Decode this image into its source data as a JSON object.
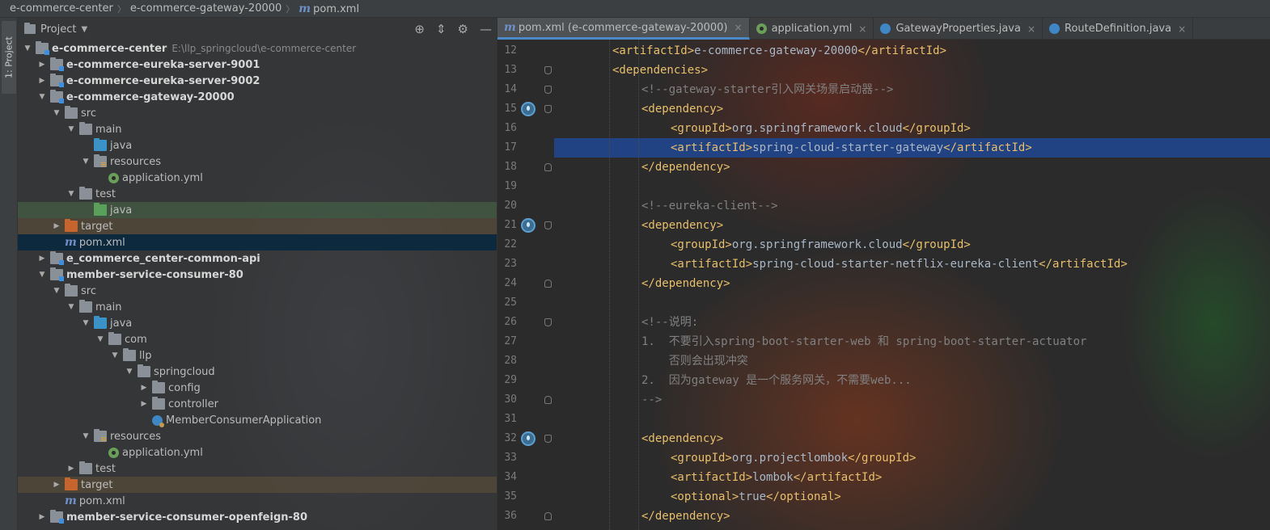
{
  "breadcrumb": {
    "items": [
      "e-commerce-center",
      "e-commerce-gateway-20000",
      "pom.xml"
    ]
  },
  "tool_window": {
    "label": "1: Project"
  },
  "project_panel": {
    "title": "Project",
    "icons": [
      "locate-icon",
      "collapse-icon",
      "gear-icon",
      "minimize-icon"
    ],
    "tree": [
      {
        "label": "e-commerce-center",
        "path": "E:\\llp_springcloud\\e-commerce-center",
        "depth": 0,
        "expanded": true,
        "icon": "module-folder",
        "bold": true
      },
      {
        "label": "e-commerce-eureka-server-9001",
        "depth": 1,
        "expanded": false,
        "icon": "module-folder",
        "bold": true
      },
      {
        "label": "e-commerce-eureka-server-9002",
        "depth": 1,
        "expanded": false,
        "icon": "module-folder",
        "bold": true
      },
      {
        "label": "e-commerce-gateway-20000",
        "depth": 1,
        "expanded": true,
        "icon": "module-folder",
        "bold": true
      },
      {
        "label": "src",
        "depth": 2,
        "expanded": true,
        "icon": "folder"
      },
      {
        "label": "main",
        "depth": 3,
        "expanded": true,
        "icon": "folder"
      },
      {
        "label": "java",
        "depth": 4,
        "icon": "source-folder"
      },
      {
        "label": "resources",
        "depth": 4,
        "expanded": true,
        "icon": "resources-folder"
      },
      {
        "label": "application.yml",
        "depth": 5,
        "icon": "yml-file"
      },
      {
        "label": "test",
        "depth": 3,
        "expanded": true,
        "icon": "folder"
      },
      {
        "label": "java",
        "depth": 4,
        "icon": "test-folder",
        "highlight": "green"
      },
      {
        "label": "target",
        "depth": 2,
        "expanded": false,
        "icon": "excluded-folder",
        "highlight": "orange"
      },
      {
        "label": "pom.xml",
        "depth": 2,
        "icon": "maven-file",
        "highlight": "selected"
      },
      {
        "label": "e_commerce_center-common-api",
        "depth": 1,
        "expanded": false,
        "icon": "module-folder",
        "bold": true
      },
      {
        "label": "member-service-consumer-80",
        "depth": 1,
        "expanded": true,
        "icon": "module-folder",
        "bold": true
      },
      {
        "label": "src",
        "depth": 2,
        "expanded": true,
        "icon": "folder"
      },
      {
        "label": "main",
        "depth": 3,
        "expanded": true,
        "icon": "folder"
      },
      {
        "label": "java",
        "depth": 4,
        "expanded": true,
        "icon": "source-folder"
      },
      {
        "label": "com",
        "depth": 5,
        "expanded": true,
        "icon": "package-folder"
      },
      {
        "label": "llp",
        "depth": 6,
        "expanded": true,
        "icon": "package-folder"
      },
      {
        "label": "springcloud",
        "depth": 7,
        "expanded": true,
        "icon": "package-folder"
      },
      {
        "label": "config",
        "depth": 8,
        "expanded": false,
        "icon": "package-folder"
      },
      {
        "label": "controller",
        "depth": 8,
        "expanded": false,
        "icon": "package-folder"
      },
      {
        "label": "MemberConsumerApplication",
        "depth": 8,
        "icon": "spring-class"
      },
      {
        "label": "resources",
        "depth": 4,
        "expanded": true,
        "icon": "resources-folder"
      },
      {
        "label": "application.yml",
        "depth": 5,
        "icon": "yml-file"
      },
      {
        "label": "test",
        "depth": 3,
        "expanded": false,
        "icon": "folder"
      },
      {
        "label": "target",
        "depth": 2,
        "expanded": false,
        "icon": "excluded-folder",
        "highlight": "orange"
      },
      {
        "label": "pom.xml",
        "depth": 2,
        "icon": "maven-file"
      },
      {
        "label": "member-service-consumer-openfeign-80",
        "depth": 1,
        "expanded": false,
        "icon": "module-folder",
        "bold": true
      }
    ]
  },
  "editor": {
    "tabs": [
      {
        "label": "pom.xml (e-commerce-gateway-20000)",
        "icon": "maven-icon",
        "active": true
      },
      {
        "label": "application.yml",
        "icon": "yml-icon"
      },
      {
        "label": "GatewayProperties.java",
        "icon": "class-icon"
      },
      {
        "label": "RouteDefinition.java",
        "icon": "class-icon"
      }
    ],
    "highlighted_line": 17,
    "run_icon_lines": [
      15,
      21,
      32
    ],
    "lines": [
      {
        "num": "12",
        "indent": 1,
        "parts": [
          {
            "k": "t",
            "s": "<artifactId>"
          },
          {
            "k": "v",
            "s": "e-commerce-gateway-20000"
          },
          {
            "k": "t",
            "s": "</artifactId>"
          }
        ]
      },
      {
        "num": "13",
        "indent": 1,
        "fold": "start",
        "parts": [
          {
            "k": "t",
            "s": "<dependencies>"
          }
        ]
      },
      {
        "num": "14",
        "indent": 2,
        "fold": "start",
        "parts": [
          {
            "k": "c",
            "s": "<!--gateway-starter引入网关场景启动器-->"
          }
        ]
      },
      {
        "num": "15",
        "indent": 2,
        "fold": "start",
        "parts": [
          {
            "k": "t",
            "s": "<dependency>"
          }
        ]
      },
      {
        "num": "16",
        "indent": 3,
        "parts": [
          {
            "k": "t",
            "s": "<groupId>"
          },
          {
            "k": "v",
            "s": "org.springframework.cloud"
          },
          {
            "k": "t",
            "s": "</groupId>"
          }
        ]
      },
      {
        "num": "17",
        "indent": 3,
        "parts": [
          {
            "k": "t",
            "s": "<artifactId>"
          },
          {
            "k": "v",
            "s": "spring-cloud-starter-gateway"
          },
          {
            "k": "t",
            "s": "</artifactId>"
          }
        ]
      },
      {
        "num": "18",
        "indent": 2,
        "fold": "end",
        "parts": [
          {
            "k": "t",
            "s": "</dependency>"
          }
        ]
      },
      {
        "num": "19",
        "indent": 0,
        "parts": []
      },
      {
        "num": "20",
        "indent": 2,
        "parts": [
          {
            "k": "c",
            "s": "<!--eureka-client-->"
          }
        ]
      },
      {
        "num": "21",
        "indent": 2,
        "fold": "start",
        "parts": [
          {
            "k": "t",
            "s": "<dependency>"
          }
        ]
      },
      {
        "num": "22",
        "indent": 3,
        "parts": [
          {
            "k": "t",
            "s": "<groupId>"
          },
          {
            "k": "v",
            "s": "org.springframework.cloud"
          },
          {
            "k": "t",
            "s": "</groupId>"
          }
        ]
      },
      {
        "num": "23",
        "indent": 3,
        "parts": [
          {
            "k": "t",
            "s": "<artifactId>"
          },
          {
            "k": "v",
            "s": "spring-cloud-starter-netflix-eureka-client"
          },
          {
            "k": "t",
            "s": "</artifactId>"
          }
        ]
      },
      {
        "num": "24",
        "indent": 2,
        "fold": "end",
        "parts": [
          {
            "k": "t",
            "s": "</dependency>"
          }
        ]
      },
      {
        "num": "25",
        "indent": 0,
        "parts": []
      },
      {
        "num": "26",
        "indent": 2,
        "fold": "start",
        "parts": [
          {
            "k": "c",
            "s": "<!--说明:"
          }
        ]
      },
      {
        "num": "27",
        "indent": 2,
        "parts": [
          {
            "k": "c",
            "s": "1.  不要引入spring-boot-starter-web 和 spring-boot-starter-actuator"
          }
        ]
      },
      {
        "num": "28",
        "indent": 2,
        "parts": [
          {
            "k": "c",
            "s": "    否则会出现冲突"
          }
        ]
      },
      {
        "num": "29",
        "indent": 2,
        "parts": [
          {
            "k": "c",
            "s": "2.  因为gateway 是一个服务网关，不需要web..."
          }
        ]
      },
      {
        "num": "30",
        "indent": 2,
        "fold": "end",
        "parts": [
          {
            "k": "c",
            "s": "-->"
          }
        ]
      },
      {
        "num": "31",
        "indent": 0,
        "parts": []
      },
      {
        "num": "32",
        "indent": 2,
        "fold": "start",
        "parts": [
          {
            "k": "t",
            "s": "<dependency>"
          }
        ]
      },
      {
        "num": "33",
        "indent": 3,
        "parts": [
          {
            "k": "t",
            "s": "<groupId>"
          },
          {
            "k": "v",
            "s": "org.projectlombok"
          },
          {
            "k": "t",
            "s": "</groupId>"
          }
        ]
      },
      {
        "num": "34",
        "indent": 3,
        "parts": [
          {
            "k": "t",
            "s": "<artifactId>"
          },
          {
            "k": "v",
            "s": "lombok"
          },
          {
            "k": "t",
            "s": "</artifactId>"
          }
        ]
      },
      {
        "num": "35",
        "indent": 3,
        "parts": [
          {
            "k": "t",
            "s": "<optional>"
          },
          {
            "k": "v",
            "s": "true"
          },
          {
            "k": "t",
            "s": "</optional>"
          }
        ]
      },
      {
        "num": "36",
        "indent": 2,
        "fold": "end",
        "parts": [
          {
            "k": "t",
            "s": "</dependency>"
          }
        ]
      }
    ]
  },
  "colors": {
    "tag": "#e8bf6a",
    "comment": "#808080",
    "text": "#a9b7c6",
    "selection": "#214283",
    "tab_underline": "#4a88c7"
  }
}
